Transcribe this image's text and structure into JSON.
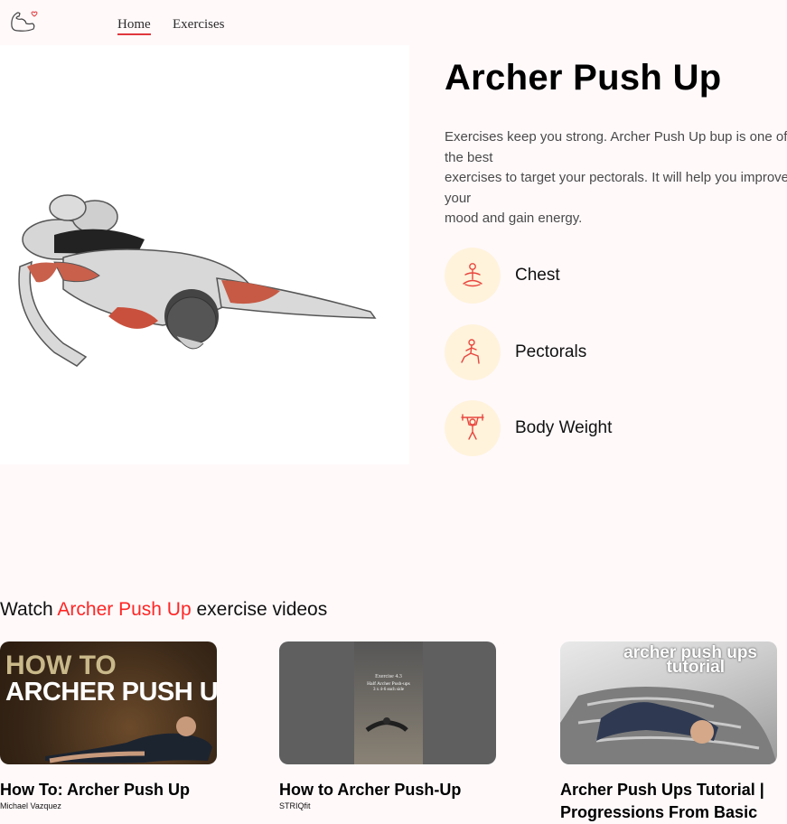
{
  "nav": {
    "home": "Home",
    "exercises": "Exercises"
  },
  "exercise": {
    "name": "Archer Push Up",
    "description_lines": [
      "Exercises keep you strong. Archer Push Up bup is one of",
      "the best",
      "exercises to target your pectorals. It will help you improve",
      "your",
      "mood and gain energy."
    ],
    "details": [
      {
        "label": "Chest",
        "icon": "body-part-icon"
      },
      {
        "label": "Pectorals",
        "icon": "target-icon"
      },
      {
        "label": "Body Weight",
        "icon": "equipment-icon"
      }
    ]
  },
  "videos": {
    "heading_prefix": "Watch",
    "heading_accent": "Archer Push Up",
    "heading_suffix": "exercise videos",
    "items": [
      {
        "title": "How To: Archer Push Up",
        "channel": "Michael Vazquez",
        "thumb_line1": "HOW TO",
        "thumb_line2": "ARCHER PUSH UP"
      },
      {
        "title": "How to Archer Push-Up",
        "channel": "STRIQfit",
        "thumb_line1": "Exercise 4.3",
        "thumb_line2": "Half Archer Push-ups",
        "thumb_line3": "3 x 4-6 each side"
      },
      {
        "title": "Archer Push Ups Tutorial | Progressions From Basic",
        "channel": "",
        "thumb_line1": "archer push ups",
        "thumb_line2": "tutorial"
      }
    ]
  },
  "colors": {
    "accent": "#ff2625",
    "chip_bg": "#fff3dc",
    "background": "#fff9fa"
  }
}
